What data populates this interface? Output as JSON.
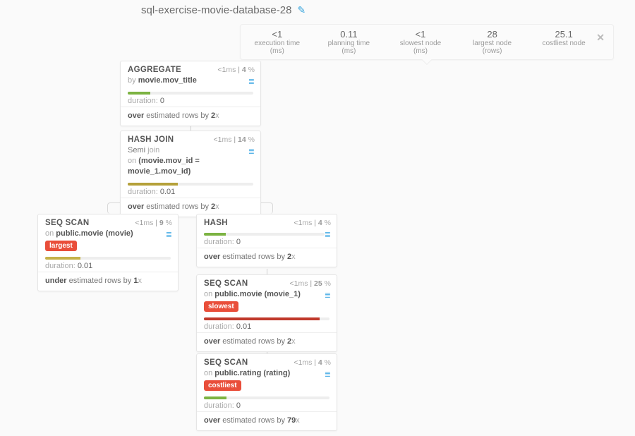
{
  "title": "sql-exercise-movie-database-28",
  "icons": {
    "edit": "✎",
    "db": "≣",
    "close": "✕"
  },
  "stats": [
    {
      "value": "<1",
      "label": "execution time (ms)"
    },
    {
      "value": "0.11",
      "label": "planning time (ms)"
    },
    {
      "value": "<1",
      "label": "slowest node (ms)"
    },
    {
      "value": "28",
      "label": "largest node (rows)"
    },
    {
      "value": "25.1",
      "label": "costliest node"
    }
  ],
  "labels": {
    "duration": "duration:",
    "over_prefix": "over",
    "under_prefix": "under",
    "est_suffix": " estimated rows by "
  },
  "nodes": {
    "aggregate": {
      "title": "AGGREGATE",
      "time": "<1",
      "pct": "4",
      "sub_prefix": "by ",
      "sub_bold": "movie.mov_title",
      "duration": "0",
      "est_dir": "over",
      "est_x": "2"
    },
    "hashjoin": {
      "title": "HASH JOIN",
      "time": "<1",
      "pct": "14",
      "line1_a": "Semi ",
      "line1_b": "join",
      "line2_a": "on ",
      "line2_b": "(movie.mov_id = movie_1.mov_id)",
      "duration": "0.01",
      "est_dir": "over",
      "est_x": "2"
    },
    "seqscan_left": {
      "title": "SEQ SCAN",
      "time": "<1",
      "pct": "9",
      "sub_prefix": "on ",
      "sub_bold": "public.movie (movie)",
      "tag": "largest",
      "duration": "0.01",
      "est_dir": "under",
      "est_x": "1"
    },
    "hash": {
      "title": "HASH",
      "time": "<1",
      "pct": "4",
      "duration": "0",
      "est_dir": "over",
      "est_x": "2"
    },
    "seqscan_mid": {
      "title": "SEQ SCAN",
      "time": "<1",
      "pct": "25",
      "sub_prefix": "on ",
      "sub_bold": "public.movie (movie_1)",
      "tag": "slowest",
      "duration": "0.01",
      "est_dir": "over",
      "est_x": "2"
    },
    "seqscan_bot": {
      "title": "SEQ SCAN",
      "time": "<1",
      "pct": "4",
      "sub_prefix": "on ",
      "sub_bold": "public.rating (rating)",
      "tag": "costliest",
      "duration": "0",
      "est_dir": "over",
      "est_x": "79"
    }
  }
}
